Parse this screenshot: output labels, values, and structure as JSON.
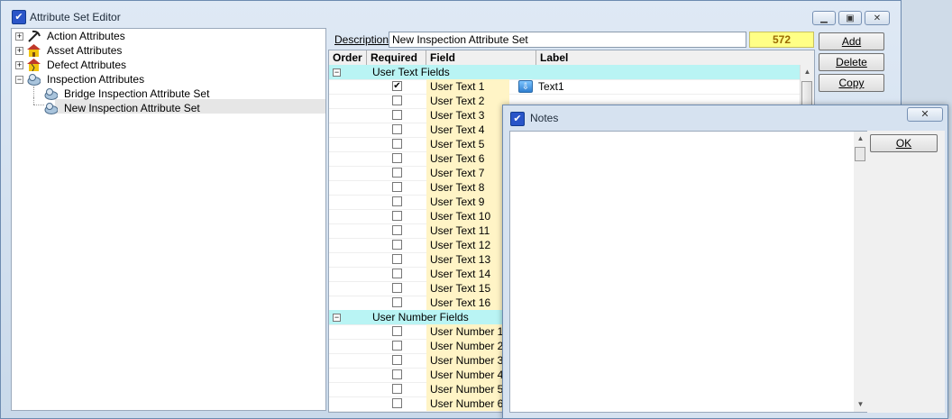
{
  "window": {
    "title": "Attribute Set Editor"
  },
  "tree": {
    "items": [
      {
        "label": "Action Attributes",
        "icon": "pickaxe-icon"
      },
      {
        "label": "Asset Attributes",
        "icon": "house-icon"
      },
      {
        "label": "Defect Attributes",
        "icon": "cracked-house-icon"
      },
      {
        "label": "Inspection Attributes",
        "icon": "inspection-icon"
      },
      {
        "label": "Bridge Inspection Attribute Set",
        "icon": "inspection-icon"
      },
      {
        "label": "New Inspection Attribute Set",
        "icon": "inspection-icon"
      }
    ]
  },
  "description": {
    "label": "Description:",
    "value": "New Inspection Attribute Set",
    "count": "572"
  },
  "buttons": {
    "add": "Add",
    "delete": "Delete",
    "copy": "Copy"
  },
  "grid": {
    "headers": [
      "Order",
      "Required",
      "Field",
      "Label"
    ],
    "groups": [
      {
        "label": "User Text Fields"
      },
      {
        "label": "User Number Fields"
      }
    ],
    "text_rows": [
      {
        "field": "User Text 1",
        "checked": true,
        "label": "Text1"
      },
      {
        "field": "User Text 2",
        "checked": false,
        "label": ""
      },
      {
        "field": "User Text 3",
        "checked": false,
        "label": ""
      },
      {
        "field": "User Text 4",
        "checked": false,
        "label": ""
      },
      {
        "field": "User Text 5",
        "checked": false,
        "label": ""
      },
      {
        "field": "User Text 6",
        "checked": false,
        "label": ""
      },
      {
        "field": "User Text 7",
        "checked": false,
        "label": ""
      },
      {
        "field": "User Text 8",
        "checked": false,
        "label": ""
      },
      {
        "field": "User Text 9",
        "checked": false,
        "label": ""
      },
      {
        "field": "User Text 10",
        "checked": false,
        "label": ""
      },
      {
        "field": "User Text 11",
        "checked": false,
        "label": ""
      },
      {
        "field": "User Text 12",
        "checked": false,
        "label": ""
      },
      {
        "field": "User Text 13",
        "checked": false,
        "label": ""
      },
      {
        "field": "User Text 14",
        "checked": false,
        "label": ""
      },
      {
        "field": "User Text 15",
        "checked": false,
        "label": ""
      },
      {
        "field": "User Text 16",
        "checked": false,
        "label": ""
      }
    ],
    "number_rows": [
      {
        "field": "User Number 1",
        "checked": false
      },
      {
        "field": "User Number 2",
        "checked": false
      },
      {
        "field": "User Number 3",
        "checked": false
      },
      {
        "field": "User Number 4",
        "checked": false
      },
      {
        "field": "User Number 5",
        "checked": false
      },
      {
        "field": "User Number 6",
        "checked": false
      }
    ]
  },
  "notes_dialog": {
    "title": "Notes",
    "ok": "OK",
    "text": ""
  }
}
